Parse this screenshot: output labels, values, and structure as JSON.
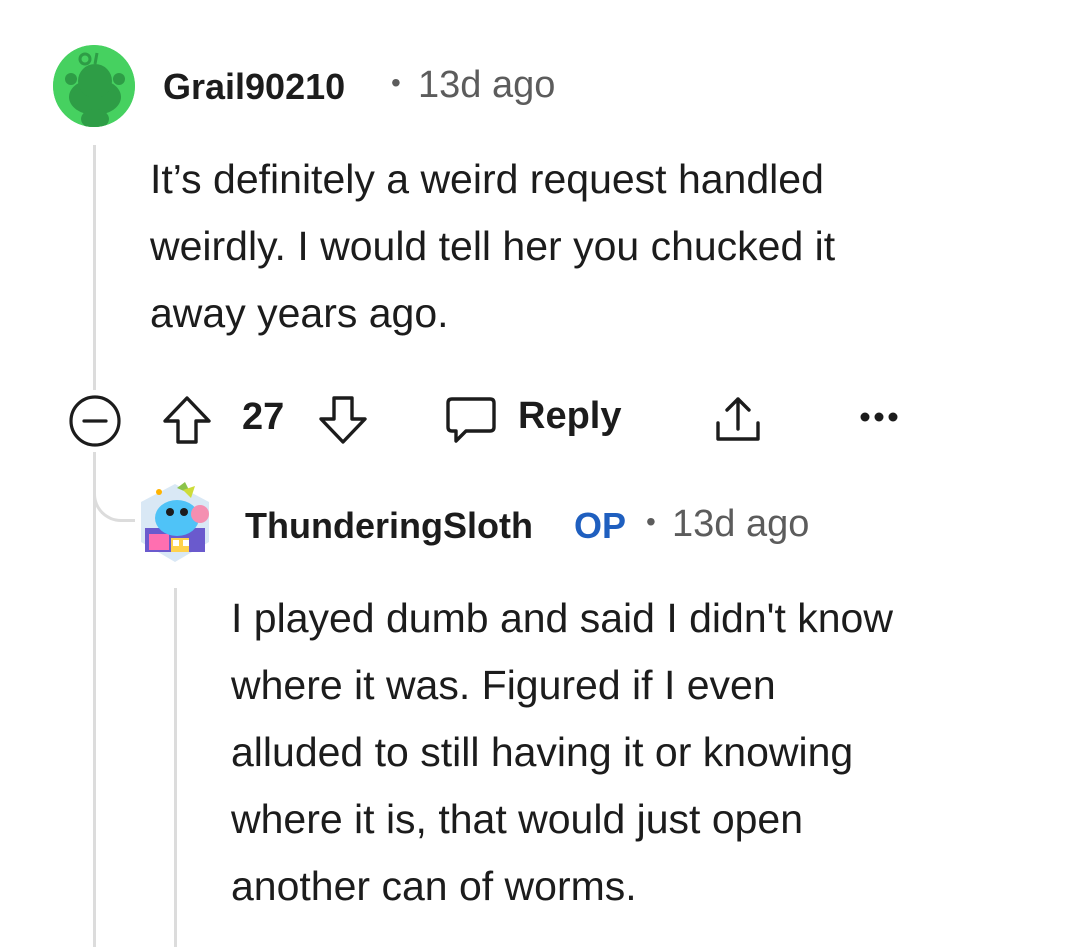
{
  "comment": {
    "author": "Grail90210",
    "separator": "•",
    "time": "13d ago",
    "body_lines": [
      "It’s definitely a weird request handled",
      "weirdly. I would tell her you chucked it",
      "away years ago."
    ],
    "avatar_icon": "reddit-snoo-avatar-icon",
    "avatar_color": "#46d160"
  },
  "actions": {
    "collapse_icon": "collapse-minus-icon",
    "upvote_icon": "upvote-arrow-icon",
    "score": "27",
    "downvote_icon": "downvote-arrow-icon",
    "reply_icon": "speech-bubble-icon",
    "reply_label": "Reply",
    "share_icon": "share-icon",
    "more_icon": "more-dots-icon"
  },
  "reply": {
    "author": "ThunderingSloth",
    "op_badge": "OP",
    "separator": "•",
    "time": "13d ago",
    "body_lines": [
      "I played dumb and said I didn't know",
      "where it was. Figured if I even",
      "alluded to still having it or knowing",
      "where it is, that would just open",
      "another can of worms."
    ],
    "avatar_icon": "custom-snoo-avatar-icon",
    "op_color": "#1f5fbf"
  }
}
